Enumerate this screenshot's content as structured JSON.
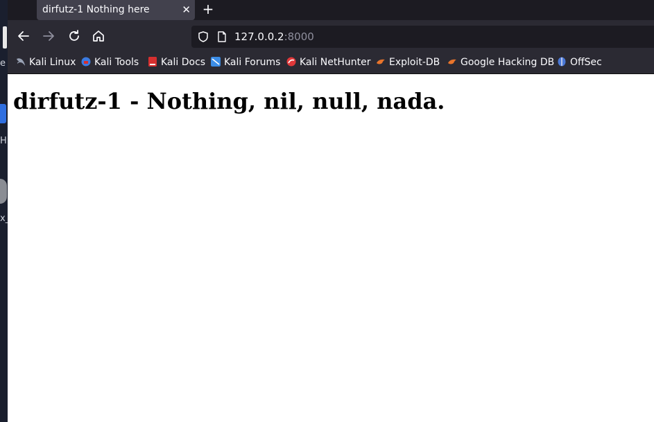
{
  "desktop": {
    "fragments": [
      "e",
      "H",
      "x_"
    ]
  },
  "browser": {
    "tab": {
      "title": "dirfutz-1 Nothing here",
      "close_glyph": "✕"
    },
    "new_tab_glyph": "+",
    "nav": {
      "back_icon": "back-arrow-icon",
      "forward_icon": "forward-arrow-icon",
      "reload_icon": "reload-icon",
      "home_icon": "home-icon"
    },
    "url": {
      "host": "127.0.0.2",
      "port": ":8000"
    },
    "bookmarks": [
      {
        "label": "Kali Linux",
        "icon": "kali-dragon-icon",
        "color": "#9aa3b5"
      },
      {
        "label": "Kali Tools",
        "icon": "kali-tools-icon",
        "color": "#3b7be0"
      },
      {
        "label": "Kali Docs",
        "icon": "kali-docs-icon",
        "color": "#d62f2f"
      },
      {
        "label": "Kali Forums",
        "icon": "kali-forums-icon",
        "color": "#3c8de6"
      },
      {
        "label": "Kali NetHunter",
        "icon": "kali-nethunter-icon",
        "color": "#e0383a"
      },
      {
        "label": "Exploit-DB",
        "icon": "exploit-db-icon",
        "color": "#e8742b"
      },
      {
        "label": "Google Hacking DB",
        "icon": "ghdb-icon",
        "color": "#e8742b"
      },
      {
        "label": "OffSec",
        "icon": "offsec-icon",
        "color": "#4a78d6"
      }
    ]
  },
  "page": {
    "heading": "dirfutz-1 - Nothing, nil, null, nada."
  }
}
